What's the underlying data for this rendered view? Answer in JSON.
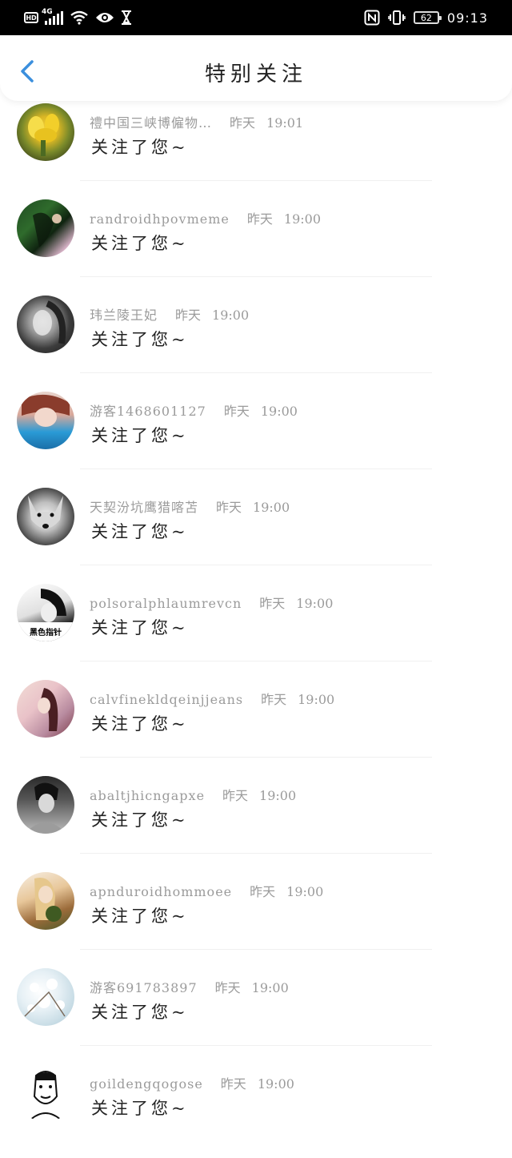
{
  "status_bar": {
    "hd": "HD",
    "network": "4G",
    "battery": "62",
    "time": "09:13",
    "icons": [
      "signal-icon",
      "wifi-icon",
      "eye-icon",
      "hourglass-icon",
      "nfc-icon",
      "vibrate-icon",
      "battery-icon"
    ]
  },
  "header": {
    "title": "特别关注",
    "back_icon": "chevron-left-icon",
    "accent": "#3b8fdd"
  },
  "items": [
    {
      "name": "禮中国三峡博僱物…",
      "date": "昨天",
      "time": "19:01",
      "action": "关注了您~"
    },
    {
      "name": "randroidhpovmeme",
      "date": "昨天",
      "time": "19:00",
      "action": "关注了您~"
    },
    {
      "name": "玮兰陵王妃",
      "date": "昨天",
      "time": "19:00",
      "action": "关注了您~"
    },
    {
      "name": "游客1468601127",
      "date": "昨天",
      "time": "19:00",
      "action": "关注了您~"
    },
    {
      "name": "天契汾坑鹰猎喀苫",
      "date": "昨天",
      "time": "19:00",
      "action": "关注了您~"
    },
    {
      "name": "polsoralphlaumrevcn",
      "date": "昨天",
      "time": "19:00",
      "action": "关注了您~",
      "avatar_text": "黑色指针"
    },
    {
      "name": "calvfinekldqeinjjeans",
      "date": "昨天",
      "time": "19:00",
      "action": "关注了您~"
    },
    {
      "name": "abaltjhicngapxe",
      "date": "昨天",
      "time": "19:00",
      "action": "关注了您~"
    },
    {
      "name": "apnduroidhommoee",
      "date": "昨天",
      "time": "19:00",
      "action": "关注了您~"
    },
    {
      "name": "游客691783897",
      "date": "昨天",
      "time": "19:00",
      "action": "关注了您~"
    },
    {
      "name": "goildengqogose",
      "date": "昨天",
      "time": "19:00",
      "action": "关注了您~"
    }
  ]
}
